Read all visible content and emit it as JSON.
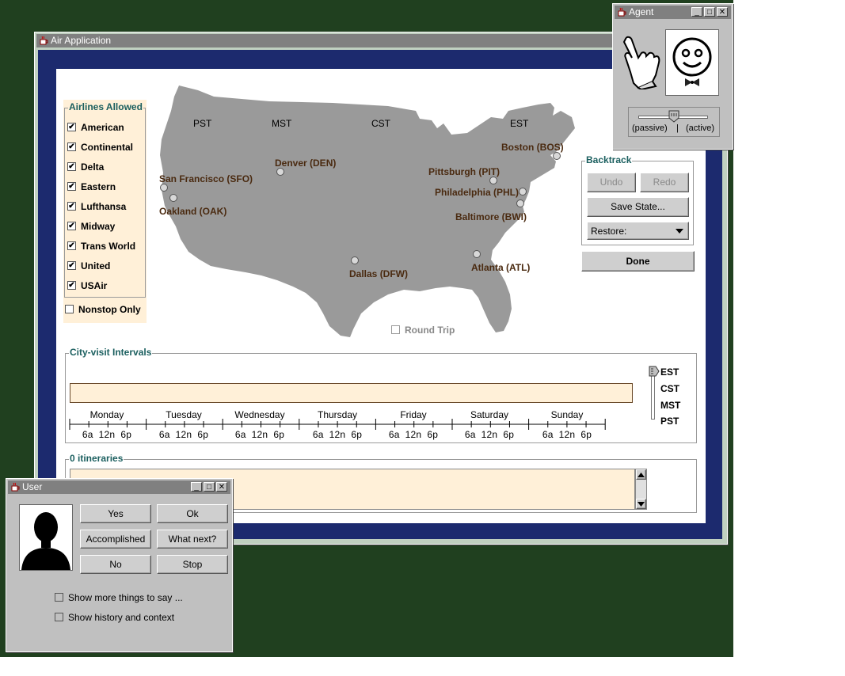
{
  "air_window": {
    "title": "Air Application",
    "airlines_group_label": "Airlines Allowed",
    "airlines": [
      {
        "label": "American",
        "checked": true
      },
      {
        "label": "Continental",
        "checked": true
      },
      {
        "label": "Delta",
        "checked": true
      },
      {
        "label": "Eastern",
        "checked": true
      },
      {
        "label": "Lufthansa",
        "checked": true
      },
      {
        "label": "Midway",
        "checked": true
      },
      {
        "label": "Trans World",
        "checked": true
      },
      {
        "label": "United",
        "checked": true
      },
      {
        "label": "USAir",
        "checked": true
      }
    ],
    "nonstop_label": "Nonstop Only",
    "nonstop_checked": false,
    "map": {
      "timezones": [
        "PST",
        "MST",
        "CST",
        "EST"
      ],
      "cities": [
        "San Francisco (SFO)",
        "Oakland (OAK)",
        "Denver (DEN)",
        "Dallas (DFW)",
        "Pittsburgh (PIT)",
        "Philadelphia (PHL)",
        "Baltimore (BWI)",
        "Boston (BOS)",
        "Atlanta (ATL)"
      ],
      "round_trip_label": "Round Trip",
      "round_trip_checked": false
    },
    "backtrack": {
      "label": "Backtrack",
      "undo": "Undo",
      "redo": "Redo",
      "save_state": "Save State...",
      "restore": "Restore:"
    },
    "done": "Done",
    "intervals": {
      "label": "City-visit Intervals",
      "days": [
        "Monday",
        "Tuesday",
        "Wednesday",
        "Thursday",
        "Friday",
        "Saturday",
        "Sunday"
      ],
      "hours": "6a  12n  6p",
      "tz_options": [
        "EST",
        "CST",
        "MST",
        "PST"
      ],
      "selected_tz": "EST"
    },
    "itineraries_label": "0 itineraries"
  },
  "agent_window": {
    "title": "Agent",
    "slider_passive": "(passive)",
    "slider_active": "(active)",
    "slider_level": 0.5
  },
  "user_window": {
    "title": "User",
    "buttons": [
      "Yes",
      "Ok",
      "Accomplished",
      "What next?",
      "No",
      "Stop"
    ],
    "show_more_label": "Show more things to say ...",
    "show_history_label": "Show history and context"
  },
  "colors": {
    "desktop": "#20401f",
    "frame_navy": "#1c2a6e",
    "map_gray": "#9a9a9a",
    "panel_cream": "#fff0d8",
    "city_label": "#4a2a10",
    "group_label": "#1b5f5f"
  }
}
